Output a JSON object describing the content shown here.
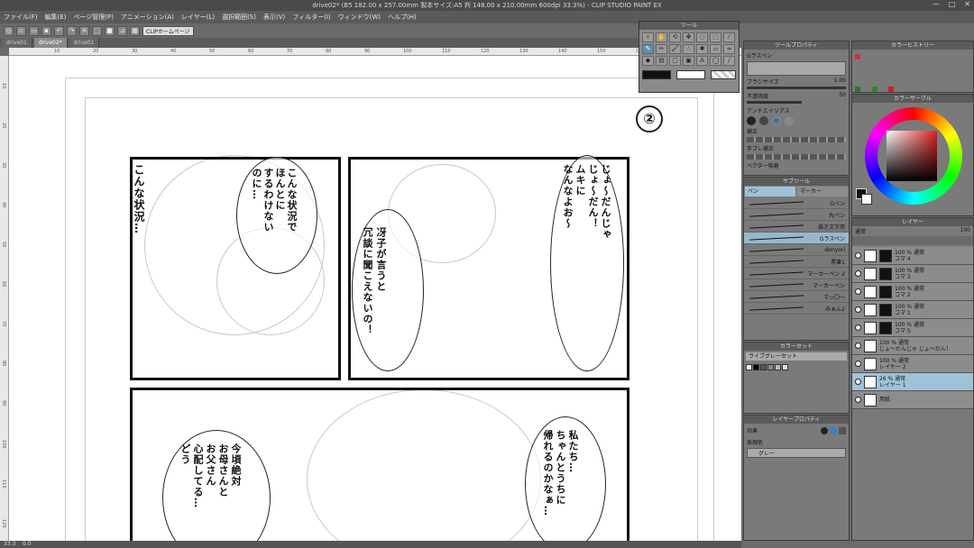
{
  "window": {
    "title": "drive02* (B5 182.00 x 257.00mm 製本サイズ:A5 判 148.00 x 210.00mm 600dpi 33.3%) - CLIP STUDIO PAINT EX",
    "min": "—",
    "max": "□",
    "close": "✕"
  },
  "menu": [
    "ファイル(F)",
    "編集(E)",
    "ページ管理(P)",
    "アニメーション(A)",
    "レイヤー(L)",
    "選択範囲(S)",
    "表示(V)",
    "フィルター(I)",
    "ウィンドウ(W)",
    "ヘルプ(H)"
  ],
  "command_bar": {
    "clip_button": "CLIPホームページ"
  },
  "tabs": [
    {
      "label": "drive01",
      "active": false
    },
    {
      "label": "drive02*",
      "active": true
    },
    {
      "label": "drive01",
      "active": false
    }
  ],
  "ruler": {
    "h_ticks": [
      "10",
      "20",
      "30",
      "40",
      "50",
      "60",
      "70",
      "80",
      "90",
      "100",
      "110",
      "120",
      "130",
      "140",
      "150",
      "160",
      "170",
      "180"
    ],
    "v_ticks": [
      "10",
      "20",
      "30",
      "40",
      "50",
      "60",
      "70",
      "80",
      "90",
      "100",
      "110",
      "120"
    ]
  },
  "canvas": {
    "page_number": "②",
    "panels": {
      "top_left_lines": [
        "こんな状況…"
      ],
      "top_left_bubble2": [
        "こんな状況で",
        "ほんとに",
        "するわけない",
        "のに…"
      ],
      "top_right_bubble1": [
        "じょ〜だんじゃ",
        "じょ〜だん！",
        "ムキに",
        "なんなよお〜"
      ],
      "top_right_bubble2": [
        "冴子が言うと",
        "冗談に聞こえないの！"
      ],
      "bottom_left_bubble": [
        "今頃絶対",
        "お母さんと",
        "お父さん",
        "心配してる…",
        "どう"
      ],
      "bottom_right_bubble": [
        "私たち…",
        "ちゃんとうちに",
        "帰れるのかなぁ…"
      ]
    }
  },
  "status": {
    "zoom": "33.3",
    "angle": "0.0"
  },
  "tool_palette": {
    "title": "ツール",
    "icons": [
      "zoom-icon",
      "hand-icon",
      "rotate-icon",
      "move-icon",
      "lasso-icon",
      "select-icon",
      "eyedropper-icon",
      "pen-icon",
      "pencil-icon",
      "brush-icon",
      "airbrush-icon",
      "decoration-icon",
      "eraser-icon",
      "blend-icon",
      "fill-icon",
      "gradient-icon",
      "figure-icon",
      "frame-icon",
      "text-icon",
      "balloon-icon",
      "line-icon"
    ]
  },
  "tool_property": {
    "title": "ツールプロパティ",
    "tool_name": "Gラスペン",
    "brush_size_label": "ブラシサイズ",
    "brush_size_value": "1.00",
    "opacity_label": "不透明度",
    "opacity_value": "50",
    "antialias_label": "アンチエイリアス",
    "stabilize_label": "補正",
    "handshake_label": "手ブレ補正",
    "vector_label": "ベクター吸着"
  },
  "subtool": {
    "title": "サブツール",
    "tabs": [
      {
        "label": "ペン",
        "active": true
      },
      {
        "label": "マーカー",
        "active": false
      }
    ],
    "items": [
      {
        "label": "Gペン",
        "selected": false
      },
      {
        "label": "丸ペン",
        "selected": false
      },
      {
        "label": "描き文字用",
        "selected": false
      },
      {
        "label": "Gラスペン",
        "selected": true
      },
      {
        "label": "donyori",
        "selected": false
      },
      {
        "label": "黒筆1",
        "selected": false
      },
      {
        "label": "マーカーペン 2",
        "selected": false
      },
      {
        "label": "マーカーペン",
        "selected": false
      },
      {
        "label": "マッ〇〜",
        "selected": false
      },
      {
        "label": "みぁん2",
        "selected": false
      }
    ]
  },
  "color_set": {
    "title": "カラーセット",
    "set_name": "ライブグレーセット"
  },
  "layer_property": {
    "title": "レイヤープロパティ",
    "effect_label": "効果",
    "display_color_label": "表現色",
    "display_color_value": "グレー"
  },
  "color_history": {
    "title": "カラーヒストリー"
  },
  "color_circle": {
    "title": "カラーサークル"
  },
  "layers_panel": {
    "title": "レイヤー",
    "blend_mode": "通常",
    "opacity": "100",
    "items": [
      {
        "line1": "100 % 通常",
        "line2": "コマ 4",
        "selected": false,
        "black": true
      },
      {
        "line1": "100 % 通常",
        "line2": "コマ 3",
        "selected": false,
        "black": true
      },
      {
        "line1": "100 % 通常",
        "line2": "コマ 2",
        "selected": false,
        "black": true
      },
      {
        "line1": "100 % 通常",
        "line2": "コマ 1",
        "selected": false,
        "black": true
      },
      {
        "line1": "100 % 通常",
        "line2": "コマ 5",
        "selected": false,
        "black": true
      },
      {
        "line1": "100 % 通常",
        "line2": "じょ〜だんじゃ じょ〜だん！",
        "selected": false,
        "black": false
      },
      {
        "line1": "100 % 通常",
        "line2": "レイヤー 2",
        "selected": false,
        "black": false
      },
      {
        "line1": "26 % 通常",
        "line2": "レイヤー 1",
        "selected": true,
        "black": false
      },
      {
        "line1": "",
        "line2": "用紙",
        "selected": false,
        "black": false
      }
    ]
  },
  "colors": {
    "accent": "#5a8fb5",
    "main_color": "#111111",
    "sub_color": "#ffffff",
    "circle_selection": "#cc3333"
  }
}
